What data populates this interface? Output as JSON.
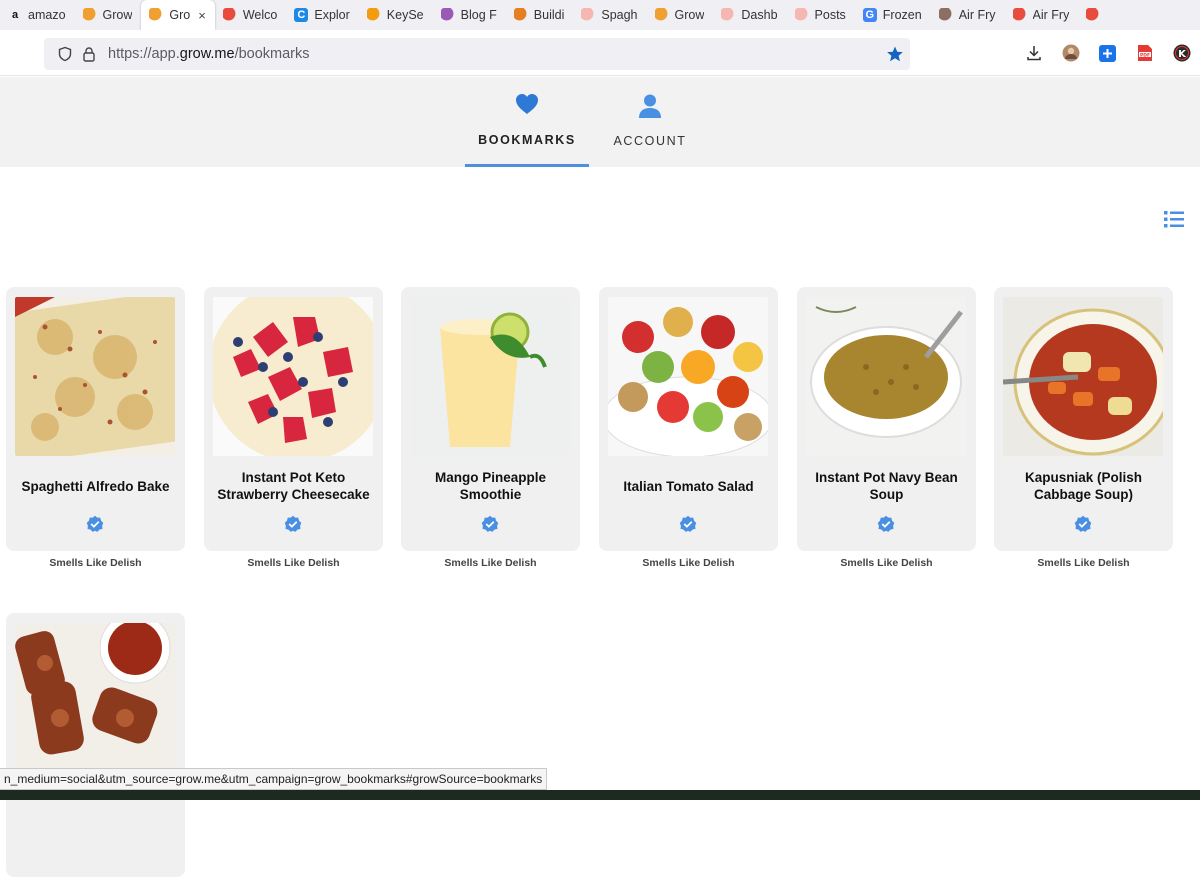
{
  "browser": {
    "tabs": [
      {
        "title": "amazo",
        "color": "#222222",
        "glyph": "a"
      },
      {
        "title": "Grow",
        "color": "#f0a030",
        "glyph": ""
      },
      {
        "title": "Gro",
        "color": "#f0a030",
        "glyph": "",
        "active": true,
        "close": "×"
      },
      {
        "title": "Welco",
        "color": "#e74c3c",
        "glyph": ""
      },
      {
        "title": "Explor",
        "color": "#1e88e5",
        "glyph": "C"
      },
      {
        "title": "KeySe",
        "color": "#f39c12",
        "glyph": ""
      },
      {
        "title": "Blog F",
        "color": "#9b59b6",
        "glyph": ""
      },
      {
        "title": "Buildi",
        "color": "#e67e22",
        "glyph": ""
      },
      {
        "title": "Spagh",
        "color": "#f5b7b1",
        "glyph": ""
      },
      {
        "title": "Grow",
        "color": "#f0a030",
        "glyph": ""
      },
      {
        "title": "Dashb",
        "color": "#f5b7b1",
        "glyph": ""
      },
      {
        "title": "Posts",
        "color": "#f5b7b1",
        "glyph": ""
      },
      {
        "title": "Frozen",
        "color": "#4285f4",
        "glyph": "G"
      },
      {
        "title": "Air Fry",
        "color": "#8d6e63",
        "glyph": ""
      },
      {
        "title": "Air Fry",
        "color": "#e74c3c",
        "glyph": ""
      },
      {
        "title": "",
        "color": "#e74c3c",
        "glyph": ""
      }
    ],
    "url_prefix": "https://app.",
    "url_domain": "grow.me",
    "url_path": "/bookmarks",
    "status_url": "n_medium=social&utm_source=grow.me&utm_campaign=grow_bookmarks#growSource=bookmarks"
  },
  "nav": {
    "bookmarks_label": "BOOKMARKS",
    "account_label": "ACCOUNT"
  },
  "colors": {
    "accent": "#2e78d6",
    "badge": "#4a90e2"
  },
  "cards": [
    {
      "title": "Spaghetti Alfredo Bake",
      "source": "Smells Like Delish",
      "image": "spaghetti-alfredo-bake-photo"
    },
    {
      "title": "Instant Pot Keto Strawberry Cheesecake",
      "source": "Smells Like Delish",
      "image": "strawberry-cheesecake-photo"
    },
    {
      "title": "Mango Pineapple Smoothie",
      "source": "Smells Like Delish",
      "image": "mango-smoothie-photo"
    },
    {
      "title": "Italian Tomato Salad",
      "source": "Smells Like Delish",
      "image": "tomato-salad-photo"
    },
    {
      "title": "Instant Pot Navy Bean Soup",
      "source": "Smells Like Delish",
      "image": "navy-bean-soup-photo"
    },
    {
      "title": "Kapusniak (Polish Cabbage Soup)",
      "source": "Smells Like Delish",
      "image": "cabbage-soup-photo"
    },
    {
      "title": "",
      "source": "",
      "image": "ribs-photo"
    }
  ]
}
